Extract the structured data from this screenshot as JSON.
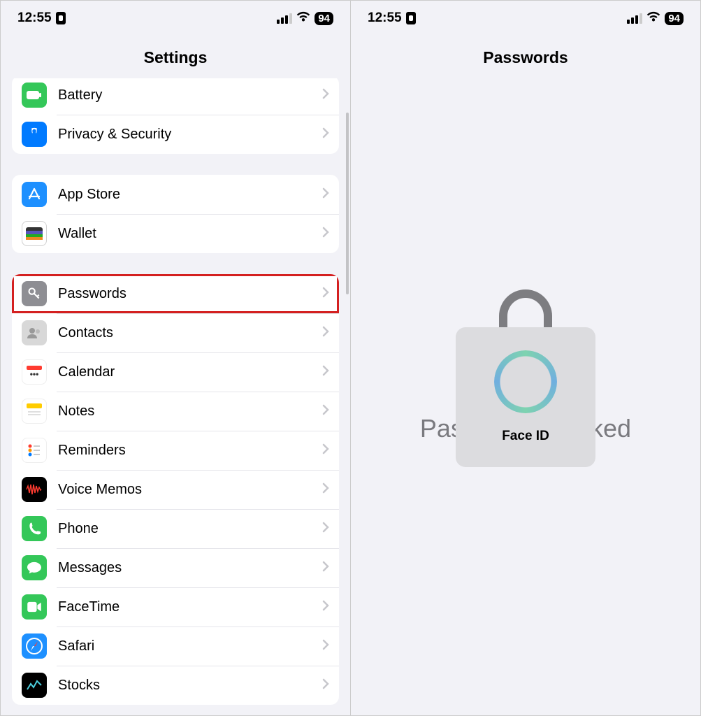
{
  "status": {
    "time": "12:55",
    "battery": "94"
  },
  "left": {
    "title": "Settings",
    "groups": [
      {
        "items": [
          {
            "key": "battery",
            "label": "Battery",
            "icon": "battery",
            "hl": false
          },
          {
            "key": "privacy",
            "label": "Privacy & Security",
            "icon": "privacy",
            "hl": false
          }
        ]
      },
      {
        "items": [
          {
            "key": "appstore",
            "label": "App Store",
            "icon": "appstore",
            "hl": false
          },
          {
            "key": "wallet",
            "label": "Wallet",
            "icon": "wallet",
            "hl": false
          }
        ]
      },
      {
        "items": [
          {
            "key": "passwords",
            "label": "Passwords",
            "icon": "passwords",
            "hl": true
          },
          {
            "key": "contacts",
            "label": "Contacts",
            "icon": "contacts",
            "hl": false
          },
          {
            "key": "calendar",
            "label": "Calendar",
            "icon": "calendar",
            "hl": false
          },
          {
            "key": "notes",
            "label": "Notes",
            "icon": "notes",
            "hl": false
          },
          {
            "key": "reminders",
            "label": "Reminders",
            "icon": "reminders",
            "hl": false
          },
          {
            "key": "voicememos",
            "label": "Voice Memos",
            "icon": "voice",
            "hl": false
          },
          {
            "key": "phone",
            "label": "Phone",
            "icon": "phone",
            "hl": false
          },
          {
            "key": "messages",
            "label": "Messages",
            "icon": "messages",
            "hl": false
          },
          {
            "key": "facetime",
            "label": "FaceTime",
            "icon": "facetime",
            "hl": false
          },
          {
            "key": "safari",
            "label": "Safari",
            "icon": "safari",
            "hl": false
          },
          {
            "key": "stocks",
            "label": "Stocks",
            "icon": "stocks",
            "hl": false
          }
        ]
      }
    ]
  },
  "right": {
    "title": "Passwords",
    "locked_text": "Passwords Locked",
    "faceid_label": "Face ID"
  }
}
